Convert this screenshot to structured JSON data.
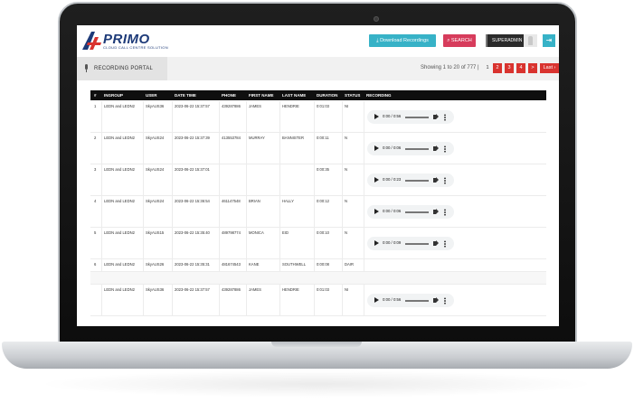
{
  "brand": {
    "name": "PRIMO",
    "tagline": "CLOUD CALL CENTRE SOLUTION",
    "color": "#1d3a78",
    "accent": "#d9332f"
  },
  "header": {
    "download_label": "⤓ Download Recordings",
    "search_label": "SEARCH",
    "user_label": "SUPERADMIN",
    "logout_icon": "logout-icon"
  },
  "portal": {
    "title": "RECORDING PORTAL",
    "showing": "Showing 1 to 20 of 777 |"
  },
  "pagination": {
    "pages": [
      "1",
      "2",
      "3",
      "4",
      ">"
    ],
    "last_label": "Last ›",
    "current": "1"
  },
  "table": {
    "columns": [
      "#",
      "INGROUP",
      "USER",
      "DATE TIME",
      "PHONE",
      "FIRST NAME",
      "LAST NAME",
      "DURATION",
      "STATUS",
      "RECORDING"
    ],
    "rows": [
      {
        "n": "1",
        "ingroup": "LEDN and LEDN2",
        "user": "SkyAUS36",
        "datetime": "2023-06-22 15:37:57",
        "phone": "439287886",
        "first": "JAMES",
        "last": "HENDRIE",
        "duration": "0:01:03",
        "status": "NI",
        "player_time": "0:00 / 0:56"
      },
      {
        "n": "2",
        "ingroup": "LEDN and LEDN2",
        "user": "SkyAUS24",
        "datetime": "2023-06-22 15:37:39",
        "phone": "413553784",
        "first": "MURRAY",
        "last": "BANNISTER",
        "duration": "0:00:11",
        "status": "N",
        "player_time": "0:00 / 0:06"
      },
      {
        "n": "3",
        "ingroup": "LEDN and LEDN2",
        "user": "SkyAUS24",
        "datetime": "2023-06-22 15:37:01",
        "phone": "",
        "first": "",
        "last": "",
        "duration": "0:00:35",
        "status": "N",
        "player_time": "0:00 / 0:23"
      },
      {
        "n": "4",
        "ingroup": "LEDN and LEDN2",
        "user": "SkyAUS24",
        "datetime": "2023-06-22 15:36:54",
        "phone": "461147548",
        "first": "BRIAN",
        "last": "HALLY",
        "duration": "0:00:12",
        "status": "N",
        "player_time": "0:00 / 0:06"
      },
      {
        "n": "5",
        "ingroup": "LEDN and LEDN2",
        "user": "SkyAUS15",
        "datetime": "2023-06-22 15:35:40",
        "phone": "489798774",
        "first": "MONICA",
        "last": "EID",
        "duration": "0:00:10",
        "status": "N",
        "player_time": "0:00 / 0:09"
      },
      {
        "n": "6",
        "ingroup": "LEDN and LEDN2",
        "user": "SkyAUS26",
        "datetime": "2023-06-22 15:35:31",
        "phone": "481674543",
        "first": "KANE",
        "last": "SOUTHWELL",
        "duration": "0:00:08",
        "status": "DAIR",
        "player_time": ""
      },
      {
        "n": "",
        "ingroup": "LEDN and LEDN2",
        "user": "SkyAUS36",
        "datetime": "2023-06-22 15:37:57",
        "phone": "439287886",
        "first": "JAMES",
        "last": "HENDRIE",
        "duration": "0:01:03",
        "status": "NI",
        "player_time": "0:00 / 0:56"
      }
    ]
  }
}
